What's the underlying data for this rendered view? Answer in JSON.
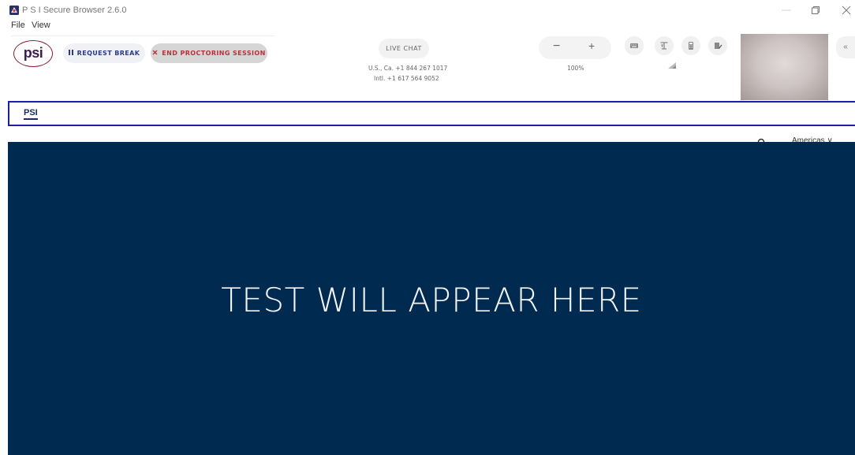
{
  "window": {
    "title": "P S I Secure Browser 2.6.0",
    "controls": {
      "minimize": "—"
    }
  },
  "menu": {
    "items": [
      "File",
      "View"
    ]
  },
  "toolbar": {
    "logo": "psi",
    "request_break": "REQUEST BREAK",
    "end_session": "END PROCTORING SESSION",
    "live_chat": "LIVE CHAT",
    "phone_us": "U.S., Ca. +1 844 267 1017",
    "phone_intl": "Intl. +1 617 564 9052",
    "zoom_minus": "−",
    "zoom_plus": "+",
    "zoom_level": "100%",
    "tools": [
      "keyboard-icon",
      "text-size-icon",
      "calculator-icon",
      "whiteboard-icon"
    ],
    "collapse": "«"
  },
  "embedded": {
    "logo": "PSI",
    "region": "Americas ∨",
    "message": "TEST WILL APPEAR HERE"
  },
  "colors": {
    "test_area_bg": "#002a4f",
    "frame_border": "#1c1fa8",
    "end_session_text": "#b8323d",
    "request_break_text": "#2b3a8b"
  }
}
